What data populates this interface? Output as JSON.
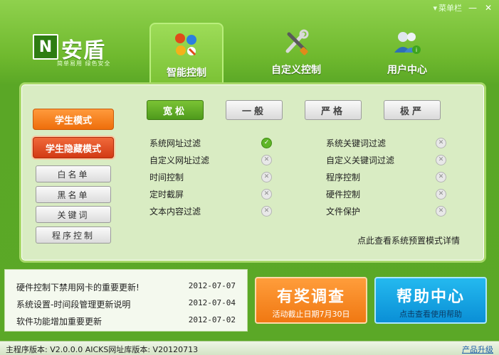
{
  "titlebar": {
    "menu_label": "菜单栏",
    "min_label": "—",
    "close_label": "✕"
  },
  "logo": {
    "letter": "N",
    "name": "安盾",
    "slogan": "简单易用 绿色安全"
  },
  "tabs": [
    {
      "label": "智能控制",
      "icon": "smart-control-icon",
      "active": true
    },
    {
      "label": "自定义控制",
      "icon": "tools-icon",
      "active": false
    },
    {
      "label": "用户中心",
      "icon": "user-center-icon",
      "active": false
    }
  ],
  "modes": {
    "student": "学生模式",
    "student_hidden": "学生隐藏模式"
  },
  "lists": [
    "白名单",
    "黑名单",
    "关键词",
    "程序控制"
  ],
  "levels": [
    "宽松",
    "一般",
    "严格",
    "极严"
  ],
  "active_level": "宽松",
  "features_left": [
    {
      "label": "系统网址过滤",
      "on": true
    },
    {
      "label": "自定义网址过滤",
      "on": false
    },
    {
      "label": "时间控制",
      "on": false
    },
    {
      "label": "定时截屏",
      "on": false
    },
    {
      "label": "文本内容过滤",
      "on": false
    }
  ],
  "features_right": [
    {
      "label": "系统关键词过滤",
      "on": false
    },
    {
      "label": "自定义关键词过滤",
      "on": false
    },
    {
      "label": "程序控制",
      "on": false
    },
    {
      "label": "硬件控制",
      "on": false
    },
    {
      "label": "文件保护",
      "on": false
    }
  ],
  "detail_link": "点此查看系统预置模式详情",
  "news": [
    {
      "title": "硬件控制下禁用网卡的重要更新!",
      "date": "2012-07-07"
    },
    {
      "title": "系统设置-时间段管理更新说明",
      "date": "2012-07-04"
    },
    {
      "title": "软件功能增加重要更新",
      "date": "2012-07-02"
    }
  ],
  "survey": {
    "title": "有奖调查",
    "sub": "活动截止日期7月30日"
  },
  "help": {
    "title": "帮助中心",
    "sub": "点击查看使用帮助"
  },
  "status": {
    "version": "主程序版本: V2.0.0.0 AICKS网址库版本: V20120713",
    "upgrade": "产品升级"
  },
  "colors": {
    "accent_green": "#5aa726",
    "orange": "#f07812",
    "blue": "#0a8fd6"
  }
}
